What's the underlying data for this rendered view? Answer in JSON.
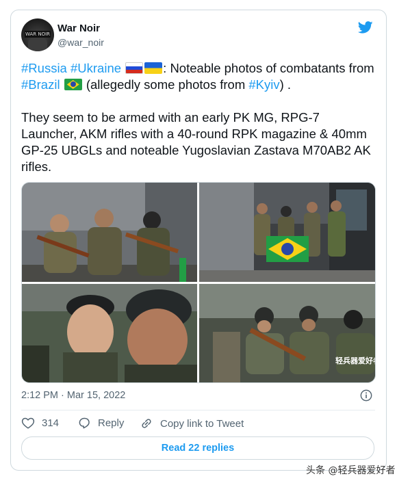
{
  "author": {
    "name": "War Noir",
    "handle": "@war_noir",
    "avatar_text": "WAR NOIR"
  },
  "tweet": {
    "tag_russia": "#Russia",
    "tag_ukraine": "#Ukraine",
    "text_1": ": Noteable photos of combatants from ",
    "tag_brazil": "#Brazil",
    "text_2": " (allegedly some photos from ",
    "tag_kyiv": "#Kyiv",
    "text_3": ") .",
    "paragraph_2": "They seem to be armed with an early PK MG, RPG-7 Launcher, AKM rifles with a 40-round RPK magazine & 40mm GP-25 UBGLs and noteable Yugoslavian Zastava M70AB2 AK rifles."
  },
  "photo_watermark": "轻兵器爱好者",
  "timestamp": "2:12 PM · Mar 15, 2022",
  "actions": {
    "like_count": "314",
    "reply_label": "Reply",
    "copy_link_label": "Copy link to Tweet"
  },
  "read_replies_label": "Read 22 replies",
  "page_watermark": "头条 @轻兵器爱好者",
  "colors": {
    "accent": "#1d9bf0",
    "secondary_text": "#536471",
    "border": "#cfd9de"
  }
}
